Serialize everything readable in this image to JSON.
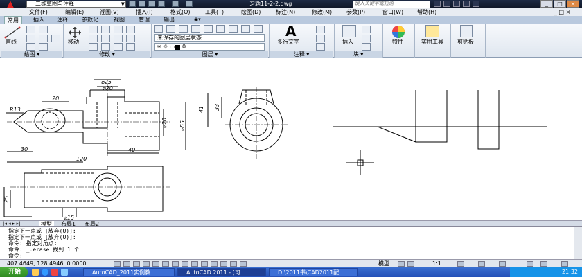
{
  "titlebar": {
    "workspace": "二维草图与注释",
    "document_title": "习题11-2-2.dwg",
    "search_placeholder": "键入关键字或短语"
  },
  "menu": [
    "文件(F)",
    "编辑(E)",
    "视图(V)",
    "插入(I)",
    "格式(O)",
    "工具(T)",
    "绘图(D)",
    "标注(N)",
    "修改(M)",
    "参数(P)",
    "窗口(W)",
    "帮助(H)"
  ],
  "tabs": [
    "常用",
    "插入",
    "注释",
    "参数化",
    "视图",
    "管理",
    "输出"
  ],
  "active_tab": 0,
  "ribbon": {
    "line_label": "直线",
    "move_label": "移动",
    "layer_state": "未保存的图层状态",
    "layer_current": "0",
    "multiline_text": "多行文字",
    "insert_label": "插入",
    "properties_label": "特性",
    "utilities_label": "实用工具",
    "clipboard_label": "剪贴板",
    "panels": [
      "绘图",
      "修改",
      "图层",
      "注释",
      "块"
    ]
  },
  "dimensions": {
    "phi25": "⌀25",
    "phi20_top": "⌀20",
    "d20": "20",
    "r13": "R13",
    "d30": "30",
    "d40": "40",
    "d120": "120",
    "phi20": "⌀20",
    "phi55": "⌀55",
    "d41": "41",
    "d33": "33",
    "d25": "25",
    "phi15": "⌀15"
  },
  "layout_tabs": [
    "模型",
    "布局1",
    "布局2"
  ],
  "command_lines": [
    "指定下一点或 [放弃(U)]:",
    "指定下一点或 [放弃(U)]:",
    "命令: 指定对角点:",
    "命令: _.erase 找到 1 个",
    "命令:"
  ],
  "status": {
    "coords": "407.4649, 128.4946, 0.0000",
    "model": "模型",
    "scale": "1:1"
  },
  "taskbar": {
    "start": "开始",
    "tasks": [
      "AutoCAD_2011实例教...",
      "AutoCAD 2011 - [习...",
      "D:\\2011书\\CAD2011配..."
    ],
    "clock": "21:32"
  }
}
